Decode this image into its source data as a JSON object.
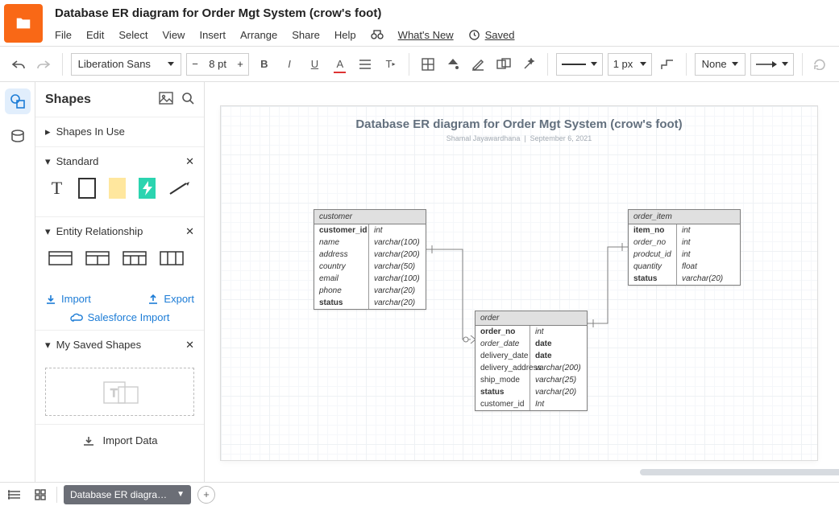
{
  "doc_title": "Database ER diagram for Order  Mgt System (crow's foot)",
  "menu": {
    "file": "File",
    "edit": "Edit",
    "select": "Select",
    "view": "View",
    "insert": "Insert",
    "arrange": "Arrange",
    "share": "Share",
    "help": "Help",
    "whats_new": "What's New",
    "saved": "Saved"
  },
  "toolbar": {
    "font": "Liberation Sans",
    "size": "8 pt",
    "line_width": "1 px",
    "endpoint_none": "None"
  },
  "shapes_panel": {
    "title": "Shapes",
    "in_use": "Shapes In Use",
    "standard": "Standard",
    "er": "Entity Relationship",
    "import": "Import",
    "export": "Export",
    "sf": "Salesforce Import",
    "saved": "My Saved Shapes",
    "import_data": "Import Data"
  },
  "diagram": {
    "title": "Database ER diagram for Order  Mgt System (crow's foot)",
    "author": "Shamal Jayawardhana",
    "date": "September 6, 2021",
    "entities": {
      "customer": {
        "name": "customer",
        "fields": [
          {
            "n": "customer_id",
            "t": "int",
            "pk": true
          },
          {
            "n": "name",
            "t": "varchar(100)"
          },
          {
            "n": "address",
            "t": "varchar(200)"
          },
          {
            "n": "country",
            "t": "varchar(50)"
          },
          {
            "n": "email",
            "t": "varchar(100)"
          },
          {
            "n": "phone",
            "t": "varchar(20)"
          },
          {
            "n": "status",
            "t": "varchar(20)",
            "b": true
          }
        ]
      },
      "order": {
        "name": "order",
        "fields": [
          {
            "n": "order_no",
            "t": "int",
            "pk": true
          },
          {
            "n": "order_date",
            "t": "date",
            "bt": true
          },
          {
            "n": "delivery_date",
            "t": "date",
            "bt": true,
            "nn": true
          },
          {
            "n": "delivery_address",
            "t": "varchar(200)",
            "nn": true
          },
          {
            "n": "ship_mode",
            "t": "varchar(25)",
            "nn": true
          },
          {
            "n": "status",
            "t": "varchar(20)",
            "b": true
          },
          {
            "n": "customer_id",
            "t": "Int",
            "nn": true
          }
        ]
      },
      "order_item": {
        "name": "order_item",
        "fields": [
          {
            "n": "item_no",
            "t": "int",
            "pk": true
          },
          {
            "n": "order_no",
            "t": "int"
          },
          {
            "n": "prodcut_id",
            "t": "int"
          },
          {
            "n": "quantity",
            "t": "float"
          },
          {
            "n": "status",
            "t": "varchar(20)",
            "b": true
          }
        ]
      }
    }
  },
  "bottom_tab": "Database ER diagra…"
}
